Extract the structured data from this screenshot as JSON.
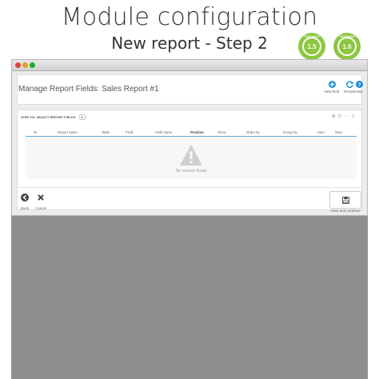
{
  "hero": {
    "title": "Module configuration",
    "subtitle": "New report - Step 2"
  },
  "badges": [
    {
      "top_text": "PRESTASHOP",
      "version": "1.5"
    },
    {
      "top_text": "PRESTASHOP",
      "version": "1.6"
    }
  ],
  "colors": {
    "accent": "#1a8fd1",
    "badge_green": "#8dc63f",
    "table_header_border": "#5aa0d6",
    "backdrop": "#8e8e8e"
  },
  "page": {
    "title": "Manage Report Fields: Sales Report #1"
  },
  "toolbar": {
    "new_field": {
      "label": "New field",
      "icon": "plus-circle-icon"
    },
    "reload": {
      "label": "Reload",
      "icon": "refresh-icon"
    },
    "help": {
      "label": "Help",
      "icon": "help-icon"
    }
  },
  "list": {
    "heading": "STEP 2/3: SELECT REPORT FIELDS",
    "count": "0",
    "columns": [
      "ID",
      "Report name",
      "Table",
      "Field",
      "Field name",
      "Position",
      "Show",
      "Order by",
      "Group by",
      "Sum",
      "Stop"
    ],
    "empty_text": "No records found"
  },
  "footer": {
    "back_label": "Back",
    "cancel_label": "Cancel",
    "save_label": "Save and continue"
  }
}
